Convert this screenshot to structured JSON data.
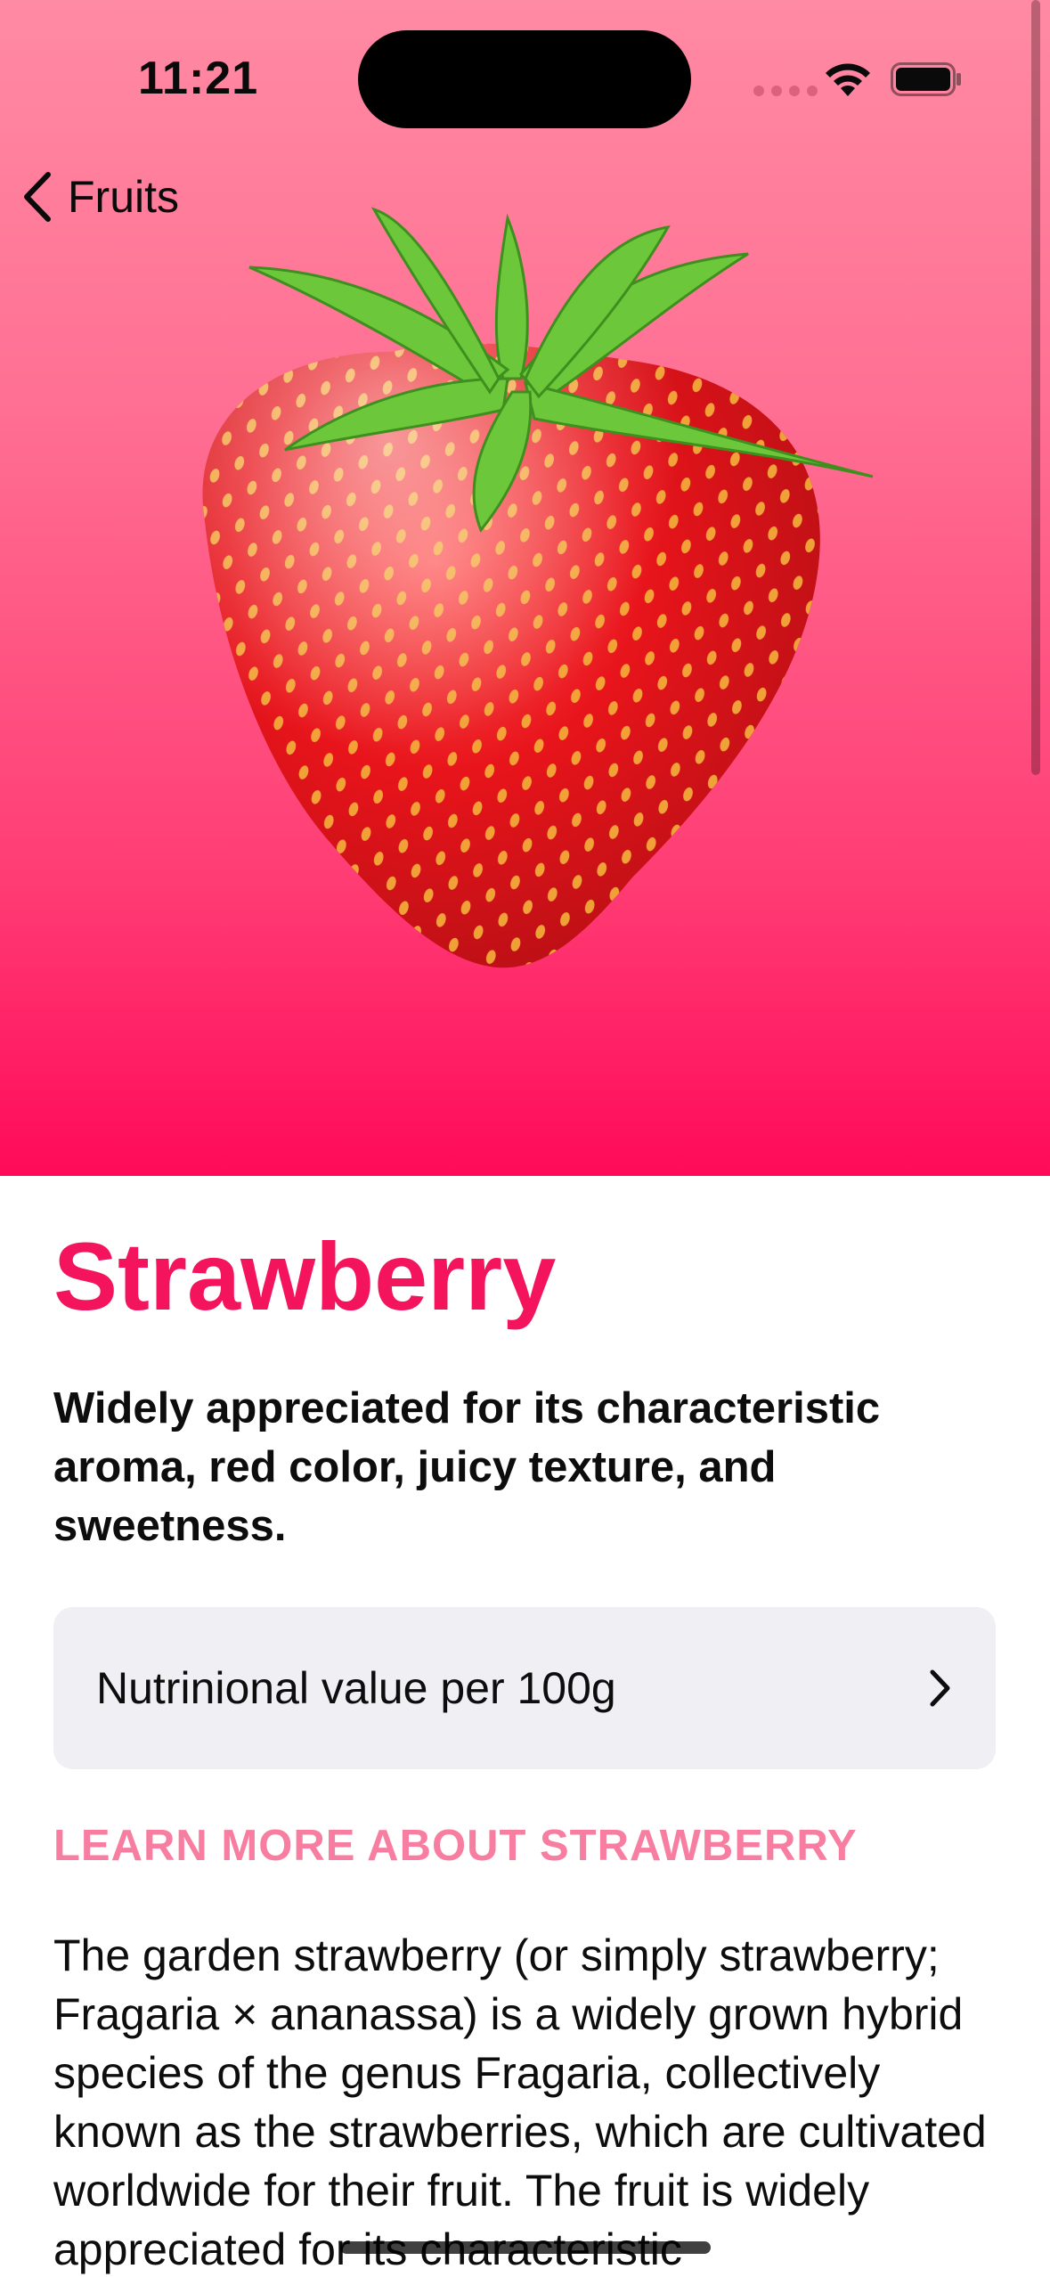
{
  "status_bar": {
    "time": "11:21"
  },
  "nav": {
    "back_label": "Fruits",
    "back_icon": "chevron-left-icon"
  },
  "hero": {
    "image": "strawberry-image",
    "gradient_top": "#ff8aa3",
    "gradient_bottom": "#ff0a59"
  },
  "fruit": {
    "title": "Strawberry",
    "headline": "Widely appreciated for its characteristic aroma,  red color, juicy texture, and sweetness.",
    "nutrition_row_label": "Nutrinional value per 100g",
    "learn_more_heading": "LEARN MORE ABOUT STRAWBERRY",
    "description": "The garden strawberry (or simply strawberry; Fragaria × ananassa) is a widely grown hybrid species of the genus Fragaria, collectively known as the strawberries, which are cultivated worldwide for their fruit. The fruit is widely appreciated for its characteristic"
  },
  "colors": {
    "accent": "#f4145e",
    "learn_more": "#f87ea1",
    "row_background": "#efeff4"
  }
}
